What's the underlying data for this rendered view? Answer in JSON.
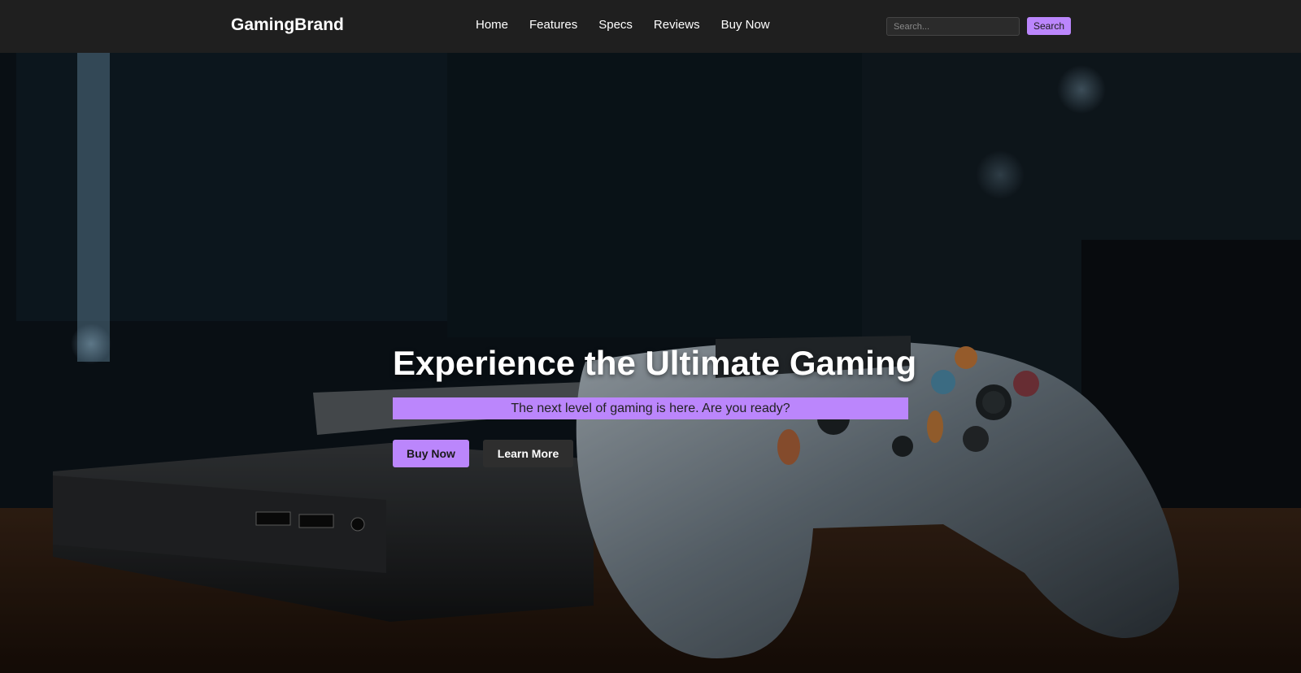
{
  "navbar": {
    "brand": "GamingBrand",
    "links": [
      "Home",
      "Features",
      "Specs",
      "Reviews",
      "Buy Now"
    ],
    "search": {
      "placeholder": "Search...",
      "button_label": "Search"
    }
  },
  "hero": {
    "title": "Experience the Ultimate Gaming",
    "subtitle": "The next level of gaming is here. Are you ready?",
    "primary_button": "Buy Now",
    "secondary_button": "Learn More",
    "image_alt": "Game console with controller on a wooden table"
  },
  "colors": {
    "navbar_bg": "#1f1f1f",
    "accent": "#bb86fc",
    "secondary_button_bg": "#2e2e2e"
  }
}
